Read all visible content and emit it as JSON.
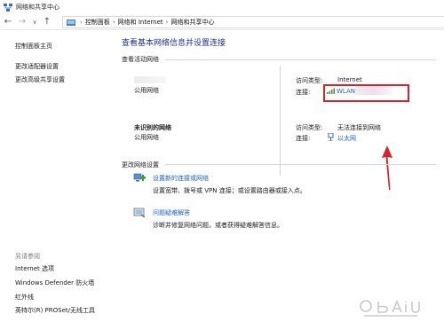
{
  "window": {
    "title": "网络和共享中心"
  },
  "addressbar": {
    "crumbs": [
      "控制面板",
      "网络和 Internet",
      "网络和共享中心"
    ]
  },
  "sidebar": {
    "links": [
      "控制面板主页",
      "更改适配器设置",
      "更改高级共享设置"
    ],
    "see_also_title": "另请参阅",
    "see_also": [
      "Internet 选项",
      "Windows Defender 防火墙",
      "红外线",
      "英特尔(R) PROSet/无线工具"
    ]
  },
  "main": {
    "heading": "查看基本网络信息并设置连接",
    "active_networks_label": "查看活动网络",
    "networks": [
      {
        "name": "",
        "type": "公用网络",
        "access_label": "访问类型:",
        "access_value": "Internet",
        "connection_label": "连接:",
        "connection_value": "WLAN"
      },
      {
        "name": "未识别的网络",
        "type": "公用网络",
        "access_label": "访问类型:",
        "access_value": "无法连接到网络",
        "connection_label": "连接:",
        "connection_value": "以太网"
      }
    ],
    "change_settings_label": "更改网络设置",
    "tasks": [
      {
        "title": "设置新的连接或网络",
        "desc": "设置宽带、拨号或 VPN 连接；或设置路由器或接入点。"
      },
      {
        "title": "问题疑难解答",
        "desc": "诊断并修复网络问题，或者获得疑难解答信息。"
      }
    ]
  },
  "colors": {
    "link": "#1e5fc8",
    "heading": "#1e3287",
    "annotation": "#d8232a"
  }
}
